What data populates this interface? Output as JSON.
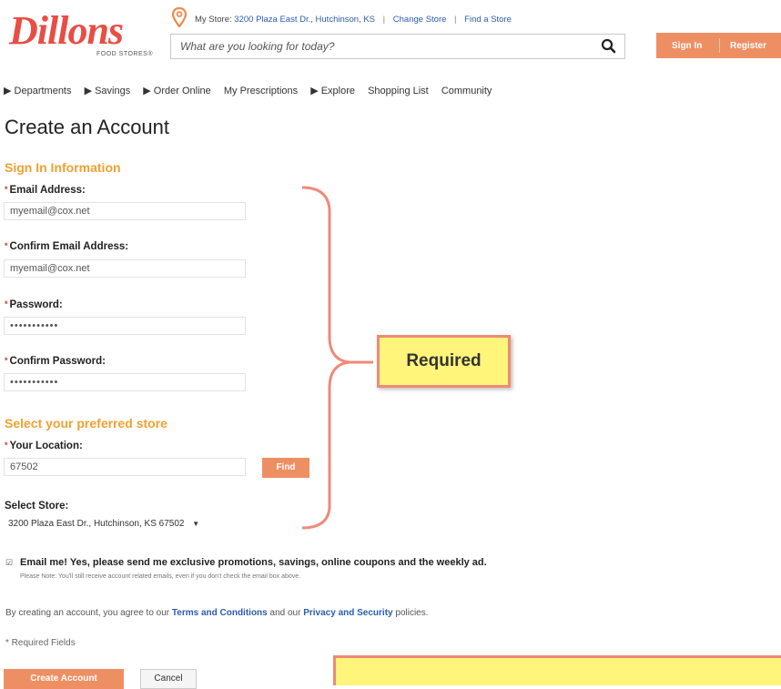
{
  "logo": {
    "text": "Dillons",
    "sub": "FOOD STORES®"
  },
  "header": {
    "my_store_label": "My Store:",
    "store_address": "3200 Plaza East Dr., Hutchinson, KS",
    "change_store": "Change Store",
    "find_store": "Find a Store",
    "separator": "|",
    "search_placeholder": "What are you looking for today?",
    "sign_in": "Sign In",
    "register": "Register",
    "accent_color": "#ee8f63"
  },
  "nav": {
    "items": [
      "▶ Departments",
      "▶ Savings",
      "▶ Order Online",
      "My Prescriptions",
      "▶ Explore",
      "Shopping List",
      "Community"
    ]
  },
  "form": {
    "title": "Create an Account",
    "sign_in_section": "Sign In Information",
    "email_label": "Email Address:",
    "email_value": "myemail@cox.net",
    "confirm_email_label": "Confirm Email Address:",
    "confirm_email_value": "myemail@cox.net",
    "password_label": "Password:",
    "password_value": "•••••••••••",
    "confirm_password_label": "Confirm Password:",
    "confirm_password_value": "•••••••••••",
    "store_section": "Select your preferred store",
    "location_label": "Your Location:",
    "location_value": "67502",
    "find_button": "Find",
    "select_store_label": "Select Store:",
    "select_store_value": "3200 Plaza East Dr., Hutchinson, KS 67502",
    "required_star": "*",
    "checkbox_mark": "☑",
    "email_me": "Email me! Yes, please send me exclusive promotions, savings, online coupons and the weekly ad.",
    "email_note": "Please Note: You'll still receive account related emails, even if you don't check the email box above.",
    "agree_prefix": "By creating an account, you agree to our",
    "terms_link": "Terms and Conditions",
    "agree_mid": "and our",
    "privacy_link": "Privacy and Security",
    "agree_suffix": "policies.",
    "required_fields": "* Required Fields",
    "create_button": "Create Account",
    "cancel_button": "Cancel"
  },
  "callout": {
    "text": "Required",
    "fill": "#fff57a",
    "border": "#ef8a78"
  }
}
